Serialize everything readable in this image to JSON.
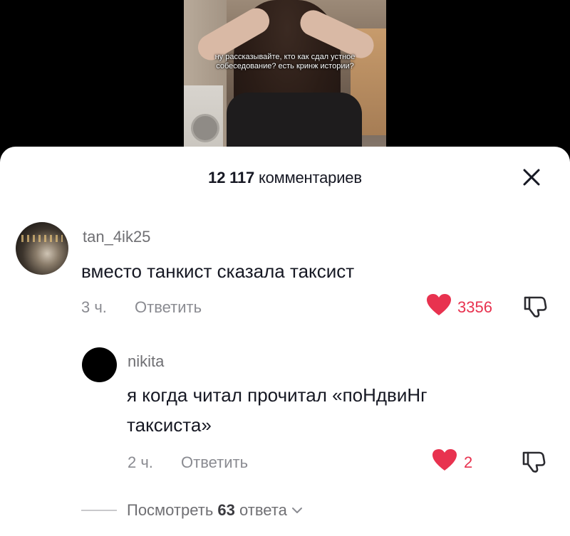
{
  "video": {
    "caption": "ну рассказывайте, кто как сдал устное собеседование? есть кринж истории?"
  },
  "header": {
    "comments_count": "12 117",
    "comments_label": "комментариев"
  },
  "comments": [
    {
      "username": "tan_4ik25",
      "text": "вместо танкист сказала таксист",
      "time": "3 ч.",
      "reply_label": "Ответить",
      "likes": "3356",
      "liked": true
    },
    {
      "username": "nikita",
      "text": "я когда читал прочитал «поНдвиНг таксиста»",
      "time": "2 ч.",
      "reply_label": "Ответить",
      "likes": "2",
      "liked": true
    }
  ],
  "view_replies": {
    "prefix": "Посмотреть",
    "count": "63",
    "suffix": "ответа"
  },
  "colors": {
    "like": "#e8324f",
    "text_primary": "#161823",
    "text_secondary": "#8a8b91"
  },
  "icons": {
    "close": "close-icon",
    "like": "heart-icon",
    "dislike": "thumbs-down-icon",
    "expand": "chevron-down-icon"
  }
}
